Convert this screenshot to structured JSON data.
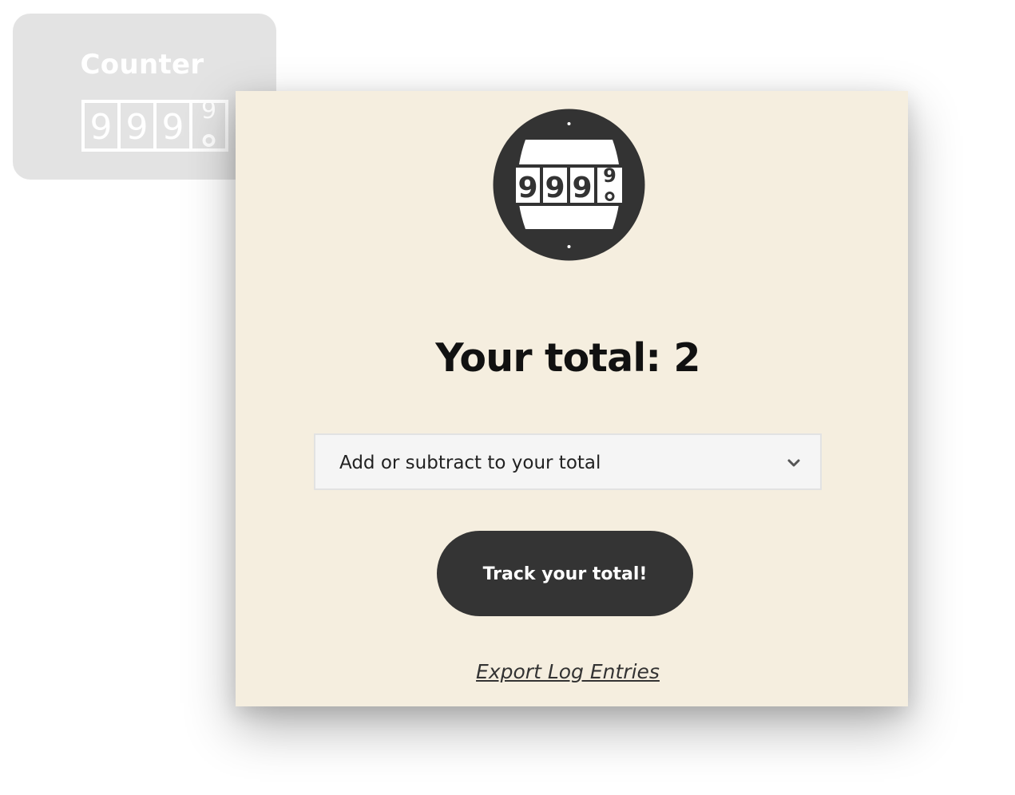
{
  "background_tile": {
    "title": "Counter",
    "icon": "odometer-counter-icon"
  },
  "card": {
    "logo_icon": "odometer-badge-icon",
    "total_label": "Your total: 2",
    "select": {
      "selected_text": "Add or subtract to your total",
      "chevron_icon": "chevron-down-icon"
    },
    "track_button_label": "Track your total!",
    "export_link_label": "Export Log Entries"
  },
  "colors": {
    "card_background": "#f5eedf",
    "button_background": "#343434",
    "logo_dark": "#333333",
    "tile_background": "#e3e3e3"
  }
}
